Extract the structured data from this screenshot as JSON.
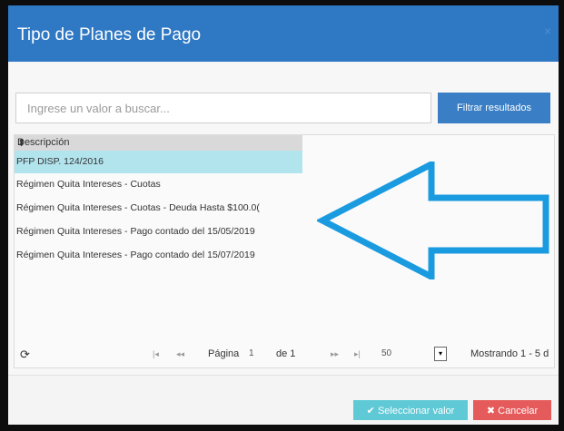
{
  "dialog": {
    "title": "Tipo de Planes de Pago",
    "close_label": "×"
  },
  "search": {
    "placeholder": "Ingrese un valor a buscar...",
    "filter_button": "Filtrar resultados"
  },
  "grid": {
    "column_header": "Descripción",
    "sort_icon": "sort-icon",
    "rows": [
      "PFP DISP. 124/2016",
      "Régimen Quita Intereses - Cuotas",
      "Régimen Quita Intereses - Cuotas - Deuda Hasta $100.0(",
      "Régimen Quita Intereses - Pago contado del 15/05/2019",
      "Régimen Quita Intereses - Pago contado del 15/07/2019"
    ],
    "selected_index": 0
  },
  "pager": {
    "page_label": "Página",
    "page_value": "1",
    "of_label": "de 1",
    "page_size": "50",
    "showing": "Mostrando 1 - 5 d"
  },
  "footer": {
    "select_button": "Seleccionar valor",
    "cancel_button": "Cancelar"
  },
  "colors": {
    "title_bar": "#2f78c4",
    "selected_row": "#b2e4ee",
    "select_button": "#5fc9d6",
    "cancel_button": "#e55b5b",
    "annotation_arrow": "#1a9be0"
  }
}
